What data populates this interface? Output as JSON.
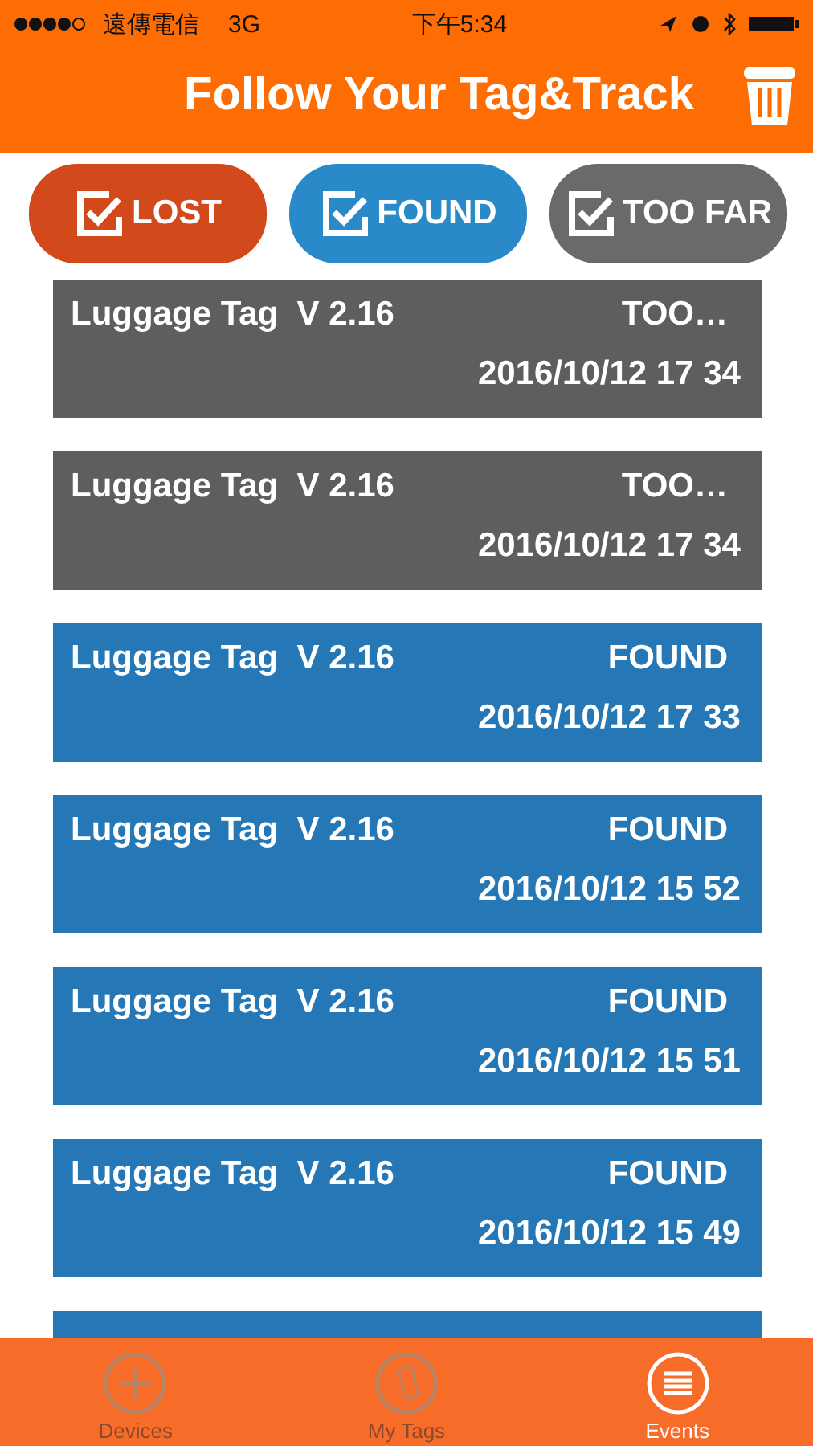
{
  "status_bar": {
    "carrier": "遠傳電信",
    "network": "3G",
    "time": "下午5:34"
  },
  "header": {
    "title": "Follow Your Tag&Track"
  },
  "filters": [
    {
      "label": "LOST",
      "kind": "lost",
      "checked": true
    },
    {
      "label": "FOUND",
      "kind": "found",
      "checked": true
    },
    {
      "label": "TOO FAR",
      "kind": "too_far",
      "checked": true
    }
  ],
  "events": [
    {
      "name": "Luggage Tag  V 2.16",
      "status": "TOO…",
      "kind": "too_far",
      "time": "2016/10/12 17 34"
    },
    {
      "name": "Luggage Tag  V 2.16",
      "status": "TOO…",
      "kind": "too_far",
      "time": "2016/10/12 17 34"
    },
    {
      "name": "Luggage Tag  V 2.16",
      "status": "FOUND",
      "kind": "found",
      "time": "2016/10/12 17 33"
    },
    {
      "name": "Luggage Tag  V 2.16",
      "status": "FOUND",
      "kind": "found",
      "time": "2016/10/12 15 52"
    },
    {
      "name": "Luggage Tag  V 2.16",
      "status": "FOUND",
      "kind": "found",
      "time": "2016/10/12 15 51"
    },
    {
      "name": "Luggage Tag  V 2.16",
      "status": "FOUND",
      "kind": "found",
      "time": "2016/10/12 15 49"
    },
    {
      "kind": "found"
    }
  ],
  "tab_bar": [
    {
      "label": "Devices",
      "kind": "plus",
      "selected": false
    },
    {
      "label": "My Tags",
      "kind": "tag",
      "selected": false
    },
    {
      "label": "Events",
      "kind": "list",
      "selected": true
    }
  ]
}
